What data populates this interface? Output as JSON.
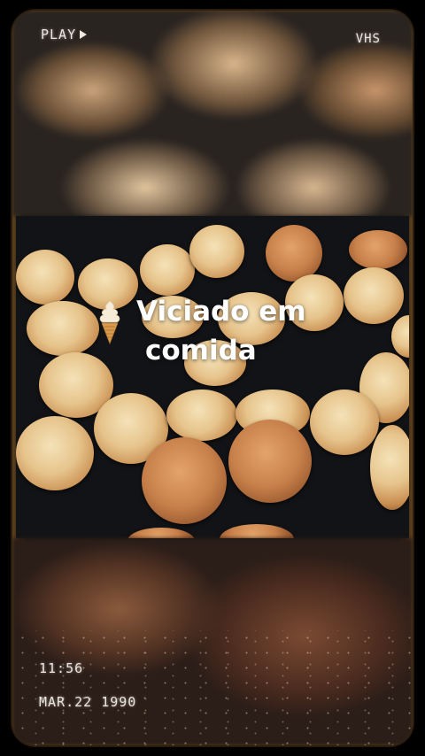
{
  "overlay": {
    "play_label": "PLAY",
    "format_label": "VHS",
    "time": "11:56",
    "date": "MAR.22 1990"
  },
  "caption": {
    "line1": "Viciado em",
    "line2": "comida",
    "emoji_icon": "soft-serve-ice-cream-icon"
  },
  "colors": {
    "frame_glow": "#dc963c",
    "text": "#ffffff",
    "vhs_text": "#ece6dc"
  }
}
